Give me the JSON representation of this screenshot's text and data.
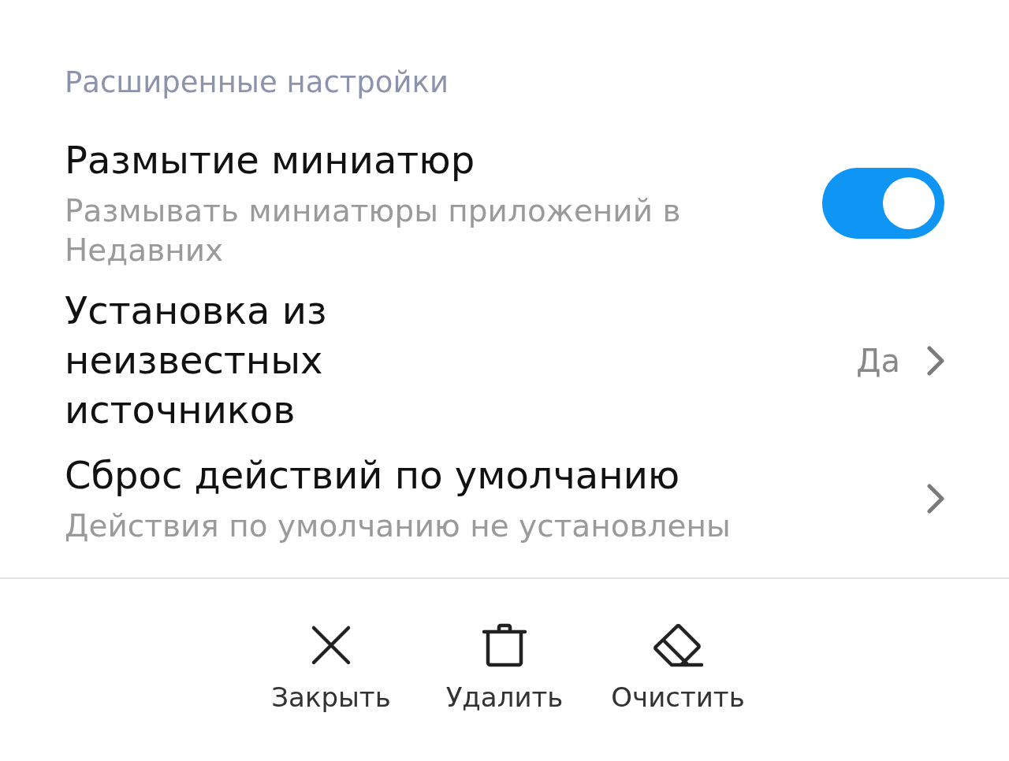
{
  "section_header": "Расширенные настройки",
  "settings": [
    {
      "kind": "toggle",
      "title": "Размытие миниатюр",
      "subtitle": "Размывать миниатюры приложений в Недавних",
      "on": true
    },
    {
      "kind": "link",
      "title": "Установка из неизвестных источников",
      "value": "Да"
    },
    {
      "kind": "link",
      "title": "Сброс действий по умолчанию",
      "subtitle": "Действия по умолчанию не установлены"
    }
  ],
  "actions": [
    {
      "kind": "close",
      "label": "Закрыть"
    },
    {
      "kind": "delete",
      "label": "Удалить"
    },
    {
      "kind": "clear",
      "label": "Очистить"
    }
  ]
}
